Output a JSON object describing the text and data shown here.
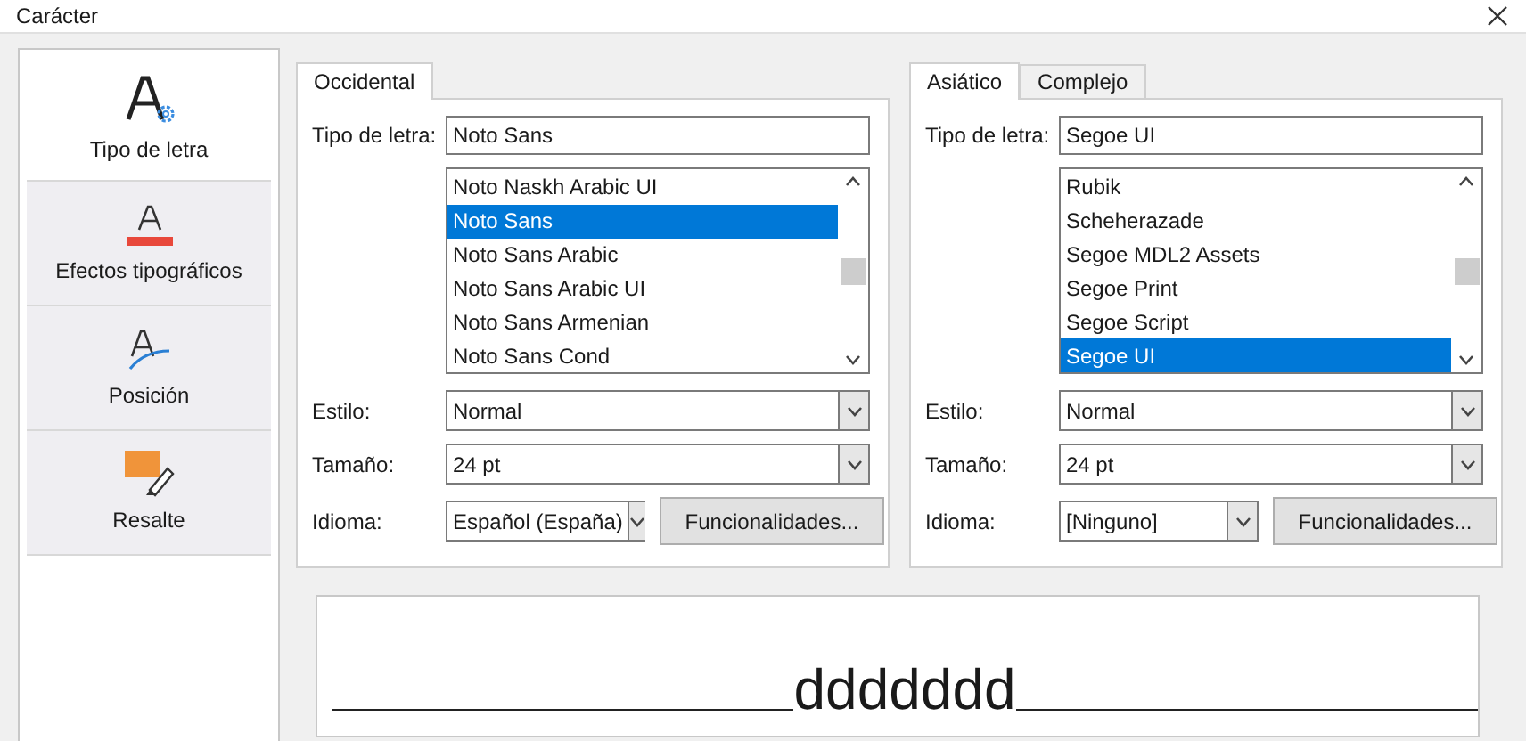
{
  "window": {
    "title": "Carácter"
  },
  "sidebar": {
    "items": [
      {
        "label": "Tipo de letra",
        "kind": "font",
        "selected": true
      },
      {
        "label": "Efectos tipográficos",
        "kind": "effects",
        "selected": false
      },
      {
        "label": "Posición",
        "kind": "position",
        "selected": false
      },
      {
        "label": "Resalte",
        "kind": "highlight",
        "selected": false
      }
    ]
  },
  "panels": [
    {
      "tabs": [
        {
          "label": "Occidental",
          "selected": true
        }
      ],
      "font_label": "Tipo de letra:",
      "font_name": "Noto Sans",
      "font_list": [
        {
          "label": "Noto Naskh Arabic UI",
          "selected": false
        },
        {
          "label": "Noto Sans",
          "selected": true
        },
        {
          "label": "Noto Sans Arabic",
          "selected": false
        },
        {
          "label": "Noto Sans Arabic UI",
          "selected": false
        },
        {
          "label": "Noto Sans Armenian",
          "selected": false
        },
        {
          "label": "Noto Sans Cond",
          "selected": false
        }
      ],
      "style_label": "Estilo:",
      "style": "Normal",
      "size_label": "Tamaño:",
      "size": "24 pt",
      "language_label": "Idioma:",
      "language": "Español (España)",
      "features_button": "Funcionalidades..."
    },
    {
      "tabs": [
        {
          "label": "Asiático",
          "selected": true
        },
        {
          "label": "Complejo",
          "selected": false
        }
      ],
      "font_label": "Tipo de letra:",
      "font_name": "Segoe UI",
      "font_list": [
        {
          "label": "Rubik",
          "selected": false
        },
        {
          "label": "Scheherazade",
          "selected": false
        },
        {
          "label": "Segoe MDL2 Assets",
          "selected": false
        },
        {
          "label": "Segoe Print",
          "selected": false
        },
        {
          "label": "Segoe Script",
          "selected": false
        },
        {
          "label": "Segoe UI",
          "selected": true
        }
      ],
      "style_label": "Estilo:",
      "style": "Normal",
      "size_label": "Tamaño:",
      "size": "24 pt",
      "language_label": "Idioma:",
      "language": "[Ninguno]",
      "features_button": "Funcionalidades..."
    }
  ],
  "preview": {
    "text": "ddddddd"
  }
}
